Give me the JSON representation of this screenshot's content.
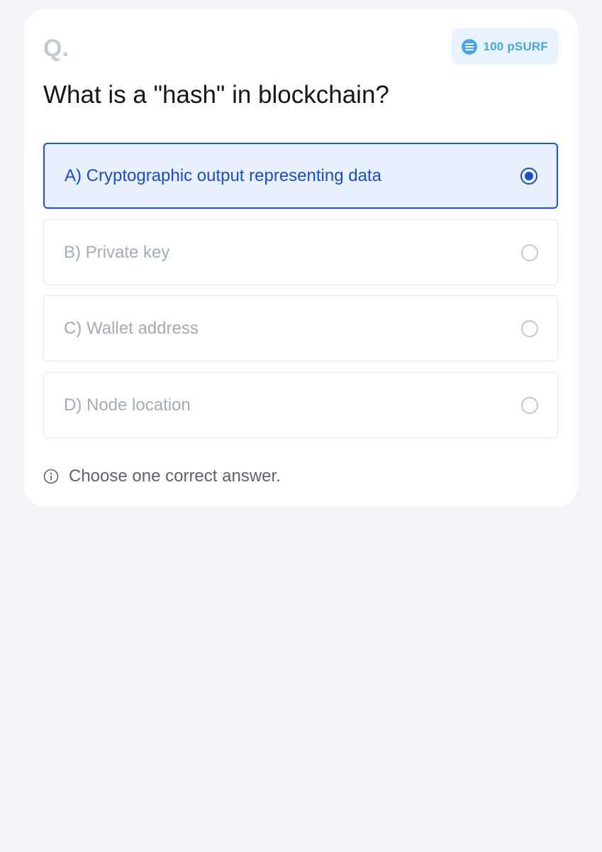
{
  "card": {
    "q_mark": "Q.",
    "reward": {
      "icon": "coin-icon",
      "label": "100 pSURF"
    },
    "question": "What is a \"hash\" in blockchain?",
    "options": [
      {
        "label": "A) Cryptographic output representing data",
        "selected": true
      },
      {
        "label": "B) Private key",
        "selected": false
      },
      {
        "label": "C) Wallet address",
        "selected": false
      },
      {
        "label": "D) Node location",
        "selected": false
      }
    ],
    "hint": {
      "icon": "info-icon",
      "text": "Choose one correct answer."
    }
  },
  "colors": {
    "accent": "#1a4ec6",
    "selected_bg": "#e8effd",
    "reward_fg": "#4aa6e8",
    "reward_bg": "#e8f3fd",
    "page_bg": "#f2f4f8"
  }
}
